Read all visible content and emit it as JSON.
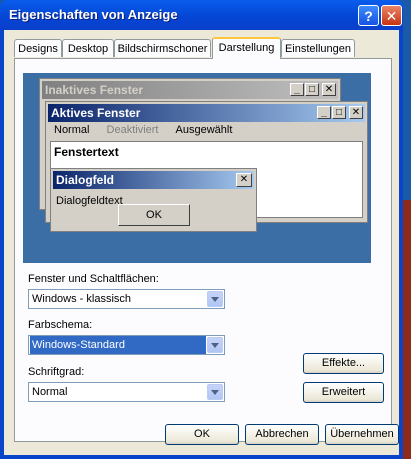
{
  "window": {
    "title": "Eigenschaften von Anzeige",
    "help_glyph": "?",
    "close_glyph": "✕"
  },
  "tabs": [
    {
      "label": "Designs"
    },
    {
      "label": "Desktop"
    },
    {
      "label": "Bildschirmschoner"
    },
    {
      "label": "Darstellung",
      "active": true
    },
    {
      "label": "Einstellungen"
    }
  ],
  "preview": {
    "inactive_title": "Inaktives Fenster",
    "active_title": "Aktives Fenster",
    "menu": {
      "normal": "Normal",
      "disabled": "Deaktiviert",
      "selected": "Ausgewählt"
    },
    "window_text": "Fenstertext",
    "dialog_title": "Dialogfeld",
    "dialog_text": "Dialogfeldtext",
    "dialog_ok": "OK"
  },
  "form": {
    "windows_buttons_label": "Fenster und Schaltflächen:",
    "windows_buttons_value": "Windows - klassisch",
    "color_scheme_label": "Farbschema:",
    "color_scheme_value": "Windows-Standard",
    "font_size_label": "Schriftgrad:",
    "font_size_value": "Normal",
    "effects_button": "Effekte...",
    "advanced_button": "Erweitert"
  },
  "footer": {
    "ok": "OK",
    "cancel": "Abbrechen",
    "apply": "Übernehmen"
  }
}
